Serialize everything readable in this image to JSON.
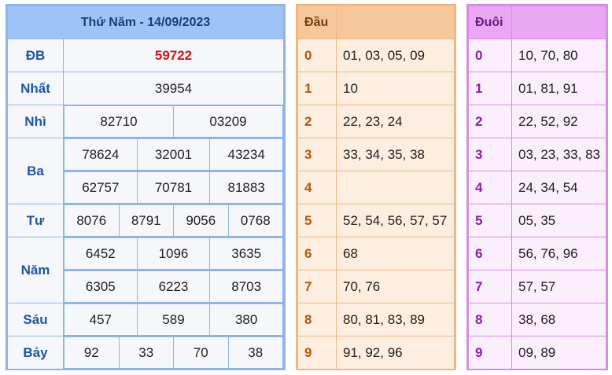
{
  "results": {
    "title": "Thứ Năm - 14/09/2023",
    "prizes": {
      "db": {
        "label": "ĐB",
        "values": [
          "59722"
        ]
      },
      "nhat": {
        "label": "Nhất",
        "values": [
          "39954"
        ]
      },
      "nhi": {
        "label": "Nhì",
        "values": [
          "82710",
          "03209"
        ]
      },
      "ba": {
        "label": "Ba",
        "values": [
          "78624",
          "32001",
          "43234",
          "62757",
          "70781",
          "81883"
        ]
      },
      "tu": {
        "label": "Tư",
        "values": [
          "8076",
          "8791",
          "9056",
          "0768"
        ]
      },
      "nam": {
        "label": "Năm",
        "values": [
          "6452",
          "1096",
          "3635",
          "6305",
          "6223",
          "8703"
        ]
      },
      "sau": {
        "label": "Sáu",
        "values": [
          "457",
          "589",
          "380"
        ]
      },
      "bay": {
        "label": "Bảy",
        "values": [
          "92",
          "33",
          "70",
          "38"
        ]
      }
    }
  },
  "head": {
    "title": "Đầu",
    "rows": [
      {
        "digit": "0",
        "values": "01, 03, 05, 09"
      },
      {
        "digit": "1",
        "values": "10"
      },
      {
        "digit": "2",
        "values": "22, 23, 24"
      },
      {
        "digit": "3",
        "values": "33, 34, 35, 38"
      },
      {
        "digit": "4",
        "values": ""
      },
      {
        "digit": "5",
        "values": "52, 54, 56, 57, 57"
      },
      {
        "digit": "6",
        "values": "68"
      },
      {
        "digit": "7",
        "values": "70, 76"
      },
      {
        "digit": "8",
        "values": "80, 81, 83, 89"
      },
      {
        "digit": "9",
        "values": "91, 92, 96"
      }
    ]
  },
  "tail": {
    "title": "Đuôi",
    "rows": [
      {
        "digit": "0",
        "values": "10, 70, 80"
      },
      {
        "digit": "1",
        "values": "01, 81, 91"
      },
      {
        "digit": "2",
        "values": "22, 52, 92"
      },
      {
        "digit": "3",
        "values": "03, 23, 33, 83"
      },
      {
        "digit": "4",
        "values": "24, 34, 54"
      },
      {
        "digit": "5",
        "values": "05, 35"
      },
      {
        "digit": "6",
        "values": "56, 76, 96"
      },
      {
        "digit": "7",
        "values": "57, 57"
      },
      {
        "digit": "8",
        "values": "38, 68"
      },
      {
        "digit": "9",
        "values": "09, 89"
      }
    ]
  }
}
